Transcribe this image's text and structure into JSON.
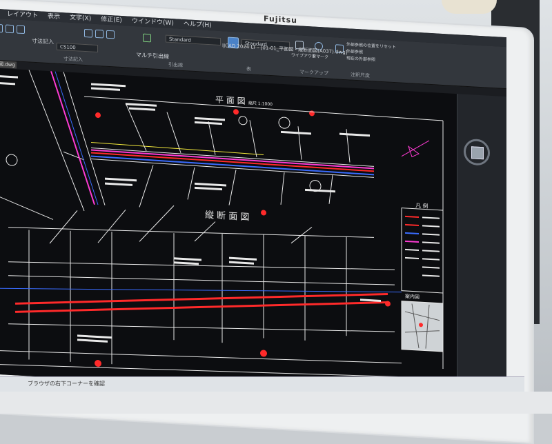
{
  "menubar": {
    "items": [
      "レイアウト",
      "表示",
      "文字(X)",
      "修正(E)",
      "ウインドウ(W)",
      "ヘルプ(H)"
    ]
  },
  "ribbon": {
    "dim_button": "寸法記入",
    "dim_style": "CS100",
    "multi_leader": "マルチ引出線",
    "std_select": "Standard",
    "std_select_2": "Standard",
    "group_dim": "寸法記入",
    "group_leader": "引出線",
    "group_markup": "マークアップ",
    "group_table": "表",
    "wipeout": "ワイプアウト",
    "revcloud": "雲マーク",
    "markup_items": [
      "外部参照の位置をリセット",
      "外部参照",
      "現在の外部参照"
    ],
    "object_label": "注釈尺度"
  },
  "window": {
    "title": "IJCAD 2024 LT - [01-01_平面図・縦断面図(A037).dwg]",
    "doc_tab": "平面図.dwg"
  },
  "drawing": {
    "plan_title": "平 面 図",
    "plan_scale": "縮尺 1:1000",
    "profile_title": "縦 断 面 図",
    "legend_title": "凡 例",
    "location_title": "案内図"
  },
  "monitor": {
    "brand": "Fujitsu"
  },
  "taskbar": {
    "status": "ブラウザの右下コーナーを確認"
  },
  "colors": {
    "canvas_bg": "#0c0d10",
    "line_white": "#e9e9e9",
    "line_red": "#ff2a2a",
    "line_magenta": "#ff3bd4",
    "line_blue": "#3a6cff",
    "line_yellow": "#f4ea3c",
    "ribbon_bg": "#33373d"
  },
  "icons": [
    "search-icon",
    "nav-cube-icon",
    "home-icon",
    "wipeout-icon",
    "revcloud-icon",
    "table-icon"
  ]
}
